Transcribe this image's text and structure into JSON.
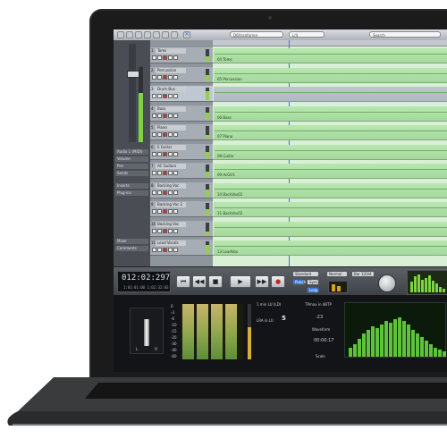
{
  "toolbar": {
    "field_left": "D6/tranfarren",
    "field_mid": "L/4",
    "search_placeholder": "Search"
  },
  "inspector": {
    "rows": [
      "Audio 1 (MIDI)",
      "Volume",
      "Pan",
      "Sends",
      "Inserts",
      "Plug-ins",
      "Mixer",
      "Comments"
    ]
  },
  "tracks": [
    {
      "num": "1",
      "name": "Toms",
      "level": 0.4
    },
    {
      "num": "2",
      "name": "Percussion",
      "level": 0.5
    },
    {
      "num": "3",
      "name": "Drum Bus",
      "level": 0.7,
      "selected": true
    },
    {
      "num": "4",
      "name": "Bass",
      "level": 0.6
    },
    {
      "num": "5",
      "name": "Piano",
      "level": 0.3
    },
    {
      "num": "6",
      "name": "E Guitar",
      "level": 0.5
    },
    {
      "num": "7",
      "name": "AC Guitars",
      "level": 0.4
    },
    {
      "num": "8",
      "name": "Backing Voc",
      "level": 0.6
    },
    {
      "num": "9",
      "name": "Backing Voc 2",
      "level": 0.5
    },
    {
      "num": "10",
      "name": "Backing Voc",
      "level": 0.3
    },
    {
      "num": "11",
      "name": "Lead Vocals",
      "level": 0.7
    }
  ],
  "lanes": [
    {
      "label": "04 Toms",
      "gray": false
    },
    {
      "label": "05 Percussion",
      "gray": false
    },
    {
      "label": "",
      "gray": true
    },
    {
      "label": "06 Bass",
      "gray": false
    },
    {
      "label": "07 Piano",
      "gray": false
    },
    {
      "label": "08 Guitar",
      "gray": false
    },
    {
      "label": "09 AcGtr1",
      "gray": false
    },
    {
      "label": "10 BackVox01",
      "gray": false
    },
    {
      "label": "11 BackVox02",
      "gray": false
    },
    {
      "label": "",
      "gray": false
    },
    {
      "label": "13 LeadVox",
      "gray": false
    }
  ],
  "transport": {
    "time_main": "012:02:297",
    "time_sub": "1:01:01:00  1:02:32:03",
    "rewind": "⏮",
    "back": "◀◀",
    "stop": "■",
    "play": "▶",
    "forward": "▶▶",
    "record": "●",
    "dropdown1": "Standard",
    "dropdown2": "Normal",
    "dropdown3": "Bar 120/4",
    "btn_punch": "Punch",
    "btn_sync": "Sync",
    "btn_loop": "Loop"
  },
  "metering": {
    "loudness_title": "1 min LU (LD)",
    "lra_label": "LRA in LU",
    "lra_value": "5",
    "true_peak_title": "TPmax in dBTP",
    "true_peak_value": "-23",
    "waveform_label": "Waveform",
    "time_value": "00:00:17",
    "scale_label": "Scale",
    "corr_labels": [
      "L",
      "R"
    ],
    "meter_scale": [
      "0",
      "-3",
      "-6",
      "-10",
      "-15",
      "-20",
      "-30",
      "-40",
      "-60"
    ]
  },
  "colors": {
    "clip_green": "#b8e6b0",
    "meter_green": "#5fc23a",
    "record_red": "#cc2222"
  }
}
